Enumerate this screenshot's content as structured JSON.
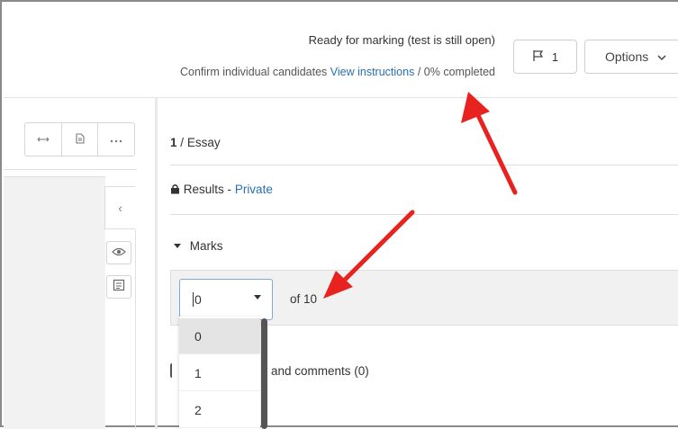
{
  "header": {
    "status": "Ready for marking (test is still open)",
    "confirm_text": "Confirm individual candidates",
    "instructions_link": "View instructions",
    "separator": "/",
    "progress": "0% completed",
    "flag_count": "1",
    "options_label": "Options"
  },
  "question": {
    "number": "1",
    "separator": "/",
    "type": "Essay"
  },
  "results": {
    "label": "Results",
    "dash": "-",
    "visibility": "Private"
  },
  "marks": {
    "label": "Marks",
    "selected_value": "0",
    "of_text": "of 10",
    "options": [
      "0",
      "1",
      "2"
    ]
  },
  "feedback": {
    "label": "and comments (0)"
  },
  "toolbar": {
    "collapse": "‹"
  },
  "colors": {
    "link": "#2a6fb0",
    "arrow": "#e8231f"
  },
  "icons": [
    "flag-icon",
    "chevron-down-icon",
    "arrows-horizontal-icon",
    "document-icon",
    "ellipsis-icon",
    "chevron-left-icon",
    "eye-icon",
    "notes-icon",
    "lock-icon",
    "caret-down-icon"
  ]
}
